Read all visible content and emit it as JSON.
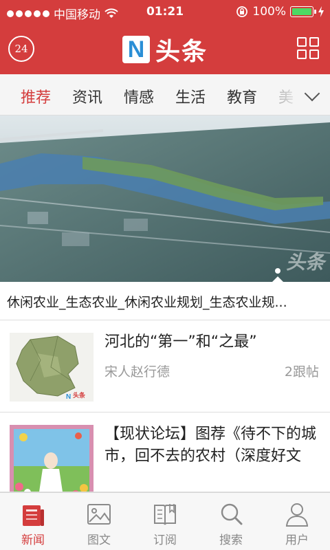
{
  "status_bar": {
    "carrier": "中国移动",
    "time": "01:21",
    "battery": "100%"
  },
  "header": {
    "logo_letter": "N",
    "logo_text": "头条",
    "clock_badge": "24",
    "icons": [
      "clock-24-icon",
      "grid-menu-icon"
    ]
  },
  "tabs": [
    "推荐",
    "资讯",
    "情感",
    "生活",
    "教育",
    "美"
  ],
  "tabs_active": 0,
  "hero": {
    "caption": "休闲农业_生态农业_休闲农业规划_生态农业规...",
    "watermark": "头条",
    "slide_index": 2
  },
  "news": [
    {
      "title": "河北的“第一”和“之最”",
      "author": "宋人赵行德",
      "comments": "2跟帖",
      "thumb_watermark": "头条"
    },
    {
      "title": "【现状论坛】图荐《待不下的城市，回不去的农村（深度好文"
    }
  ],
  "bottom_nav": [
    {
      "label": "新闻",
      "icon": "newspaper-icon"
    },
    {
      "label": "图文",
      "icon": "image-icon"
    },
    {
      "label": "订阅",
      "icon": "book-icon"
    },
    {
      "label": "搜索",
      "icon": "search-icon"
    },
    {
      "label": "用户",
      "icon": "user-icon"
    }
  ],
  "colors": {
    "brand_red": "#d43d3d",
    "logo_blue": "#2b8fd6"
  }
}
